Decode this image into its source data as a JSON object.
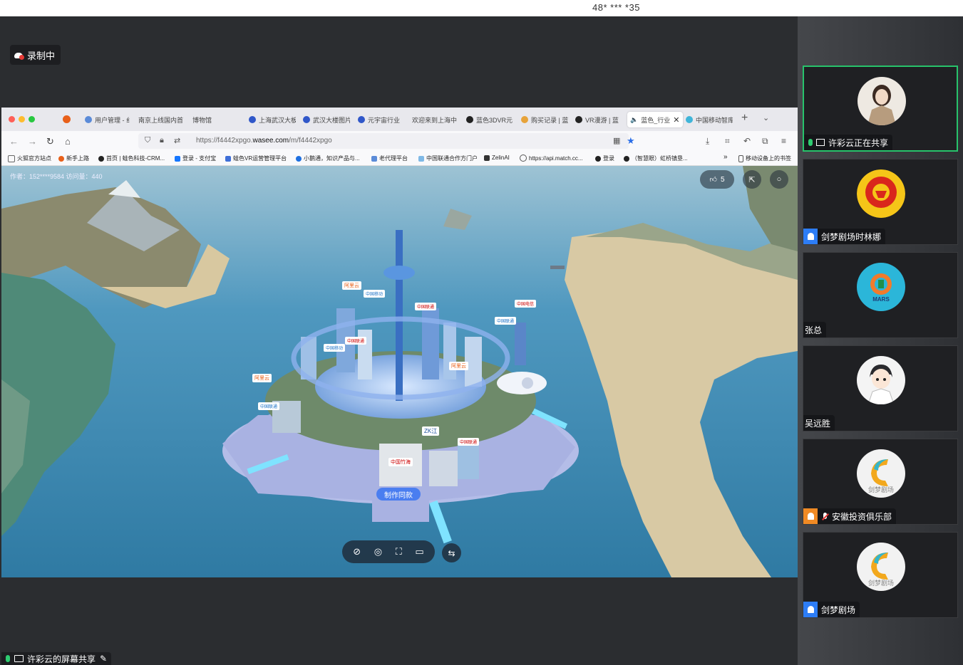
{
  "top_number": "48* *** *35",
  "recording_label": "录制中",
  "browser": {
    "tabs": [
      "用户管理 - 纟",
      "南京上线国内首",
      "博物馆",
      "上海武汉大板",
      "武汉大楼图片",
      "元宇宙行业",
      "欢迎来到上海中",
      "蓝色3DVR元",
      "购买记录 | 蓝",
      "VR漫游 | 蓝",
      "蓝色_行业",
      "中国移动智库"
    ],
    "active_tab_index": 10,
    "url_prefix": "https://f4442xpgo.",
    "url_domain": "wasee.com",
    "url_path": "/m/f4442xpgo",
    "bookmarks": [
      "火狐官方站点",
      "新手上路",
      "首页 | 蛙色科技-CRM...",
      "登录 - 支付宝",
      "蛙色VR运营管理平台",
      "小鹅通，知识产品与...",
      "老代理平台",
      "中国联通合作方门户",
      "ZelinAI",
      "https://api.match.cc...",
      "登录",
      "（智慧眼）虹桥镇垦...",
      "移动设备上的书签"
    ]
  },
  "scene": {
    "author": "作者：152****9584   访问量：440",
    "likes": "5",
    "make_same": "制作同款",
    "signs": [
      "阿里云",
      "中国移动",
      "中国联通",
      "中国电信",
      "阿里云",
      "中国联通",
      "中国联通",
      "中国移动",
      "阿里云",
      "中国联通",
      "ZK江",
      "中国联通",
      "中国竹海"
    ]
  },
  "share_label": "许彩云的屏幕共享",
  "participants": [
    {
      "name": "许彩云正在共享",
      "type": "sharing",
      "active": true
    },
    {
      "name": "剑梦剧场时林娜",
      "type": "user-blue"
    },
    {
      "name": "张总",
      "type": "plain"
    },
    {
      "name": "吴远胜",
      "type": "plain"
    },
    {
      "name": "安徽投资俱乐部",
      "type": "user-orange-muted"
    },
    {
      "name": "剑梦剧场",
      "type": "user-blue"
    }
  ],
  "avatar_texts": [
    "MARS",
    "剑梦剧场",
    "剑梦剧场"
  ],
  "colors": {
    "active_border": "#27c36b",
    "url_blue": "#2a6ee8",
    "make_button": "#4a7ef0"
  }
}
